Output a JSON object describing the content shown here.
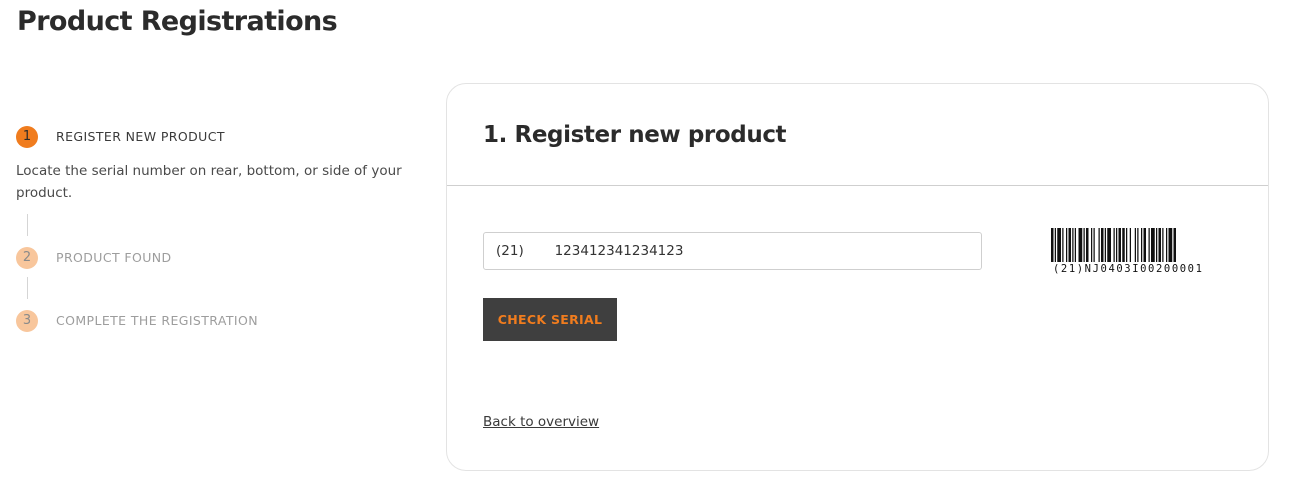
{
  "page": {
    "title": "Product Registrations"
  },
  "stepper": {
    "steps": [
      {
        "number": "1",
        "label": "REGISTER NEW PRODUCT",
        "state": "active"
      },
      {
        "number": "2",
        "label": "PRODUCT FOUND",
        "state": "inactive"
      },
      {
        "number": "3",
        "label": "COMPLETE THE REGISTRATION",
        "state": "inactive"
      }
    ],
    "active_description": "Locate the serial number on rear, bottom, or side of your product."
  },
  "card": {
    "title": "1. Register new product",
    "serial_input": {
      "value": "(21)   123412341234123",
      "placeholder": ""
    },
    "check_button_label": "CHECK SERIAL",
    "back_link_label": "Back to overview",
    "barcode_text": "(21)NJ0403I00200001"
  },
  "colors": {
    "accent": "#f07c1e",
    "accent_light": "#f8c69c",
    "button_bg": "#3f3f3f",
    "text": "#2b2b2b"
  }
}
